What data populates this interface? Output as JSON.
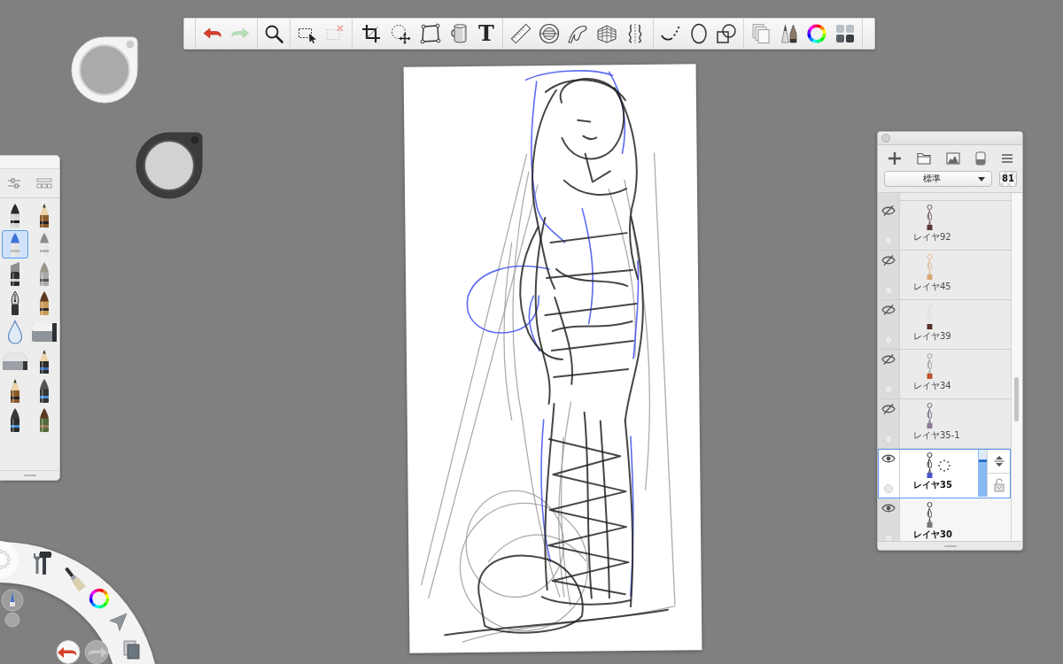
{
  "toolbar": {
    "tools": [
      {
        "disabled": false
      },
      {
        "disabled": true
      },
      {
        "disabled": false
      },
      {
        "disabled": false
      },
      {
        "disabled": true
      },
      {
        "disabled": false
      },
      {
        "disabled": false
      },
      {
        "disabled": false
      },
      {
        "disabled": false
      },
      {
        "label": "T",
        "disabled": false
      },
      {
        "disabled": false
      },
      {
        "disabled": false
      },
      {
        "disabled": false
      },
      {
        "disabled": false
      },
      {
        "disabled": false
      },
      {
        "disabled": false
      },
      {
        "disabled": false
      },
      {
        "disabled": false
      },
      {
        "disabled": false
      },
      {
        "disabled": false
      },
      {
        "disabled": false
      },
      {
        "disabled": false
      }
    ]
  },
  "brush_palette": {
    "brushes": [
      {
        "selected": false
      },
      {
        "selected": false
      },
      {
        "selected": true
      },
      {
        "selected": false
      },
      {
        "selected": false
      },
      {
        "selected": false
      },
      {
        "selected": false
      },
      {
        "selected": false
      },
      {
        "selected": false
      },
      {
        "selected": false
      },
      {
        "selected": false
      },
      {
        "selected": false
      },
      {
        "selected": false
      },
      {
        "selected": false
      },
      {
        "selected": false
      },
      {
        "selected": false
      }
    ]
  },
  "layers_panel": {
    "blend_mode": "標準",
    "opacity": "81",
    "layers": [
      {
        "name": "レイヤ92",
        "visible": false,
        "selected": false
      },
      {
        "name": "レイヤ45",
        "visible": false,
        "selected": false
      },
      {
        "name": "レイヤ39",
        "visible": false,
        "selected": false
      },
      {
        "name": "レイヤ34",
        "visible": false,
        "selected": false
      },
      {
        "name": "レイヤ35-1",
        "visible": false,
        "selected": false
      },
      {
        "name": "レイヤ35",
        "visible": true,
        "selected": true,
        "level": 0.8
      },
      {
        "name": "レイヤ30",
        "visible": true,
        "selected": false
      }
    ]
  },
  "lagoon": {
    "undo": {
      "disabled": false
    },
    "redo": {
      "disabled": true
    }
  }
}
